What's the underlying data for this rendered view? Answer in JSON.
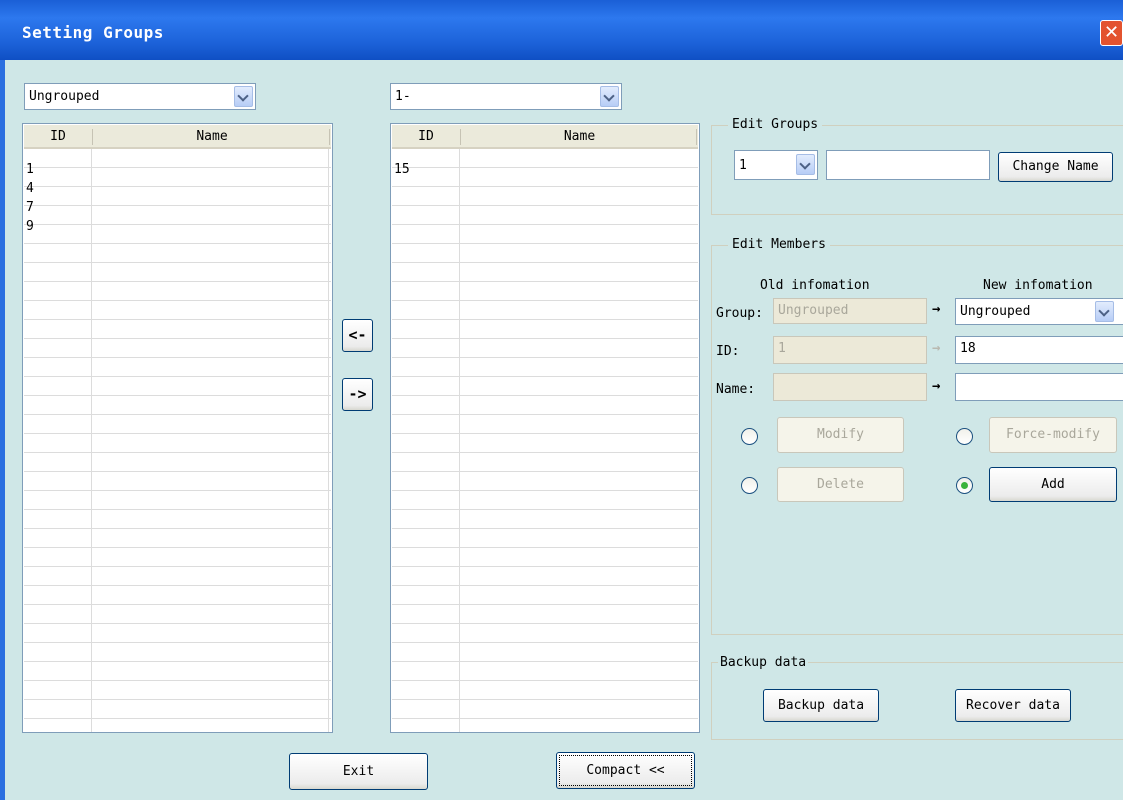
{
  "window": {
    "title": "Setting Groups",
    "close_glyph": "✕"
  },
  "left_panel": {
    "group_select": "Ungrouped",
    "columns": [
      "ID",
      "Name"
    ],
    "rows": [
      {
        "id": "1",
        "name": ""
      },
      {
        "id": "4",
        "name": ""
      },
      {
        "id": "7",
        "name": ""
      },
      {
        "id": "9",
        "name": ""
      }
    ]
  },
  "middle_panel": {
    "group_select": "1-",
    "columns": [
      "ID",
      "Name"
    ],
    "rows": [
      {
        "id": "15",
        "name": ""
      }
    ]
  },
  "transfer": {
    "to_left": "<-",
    "to_right": "->"
  },
  "edit_groups": {
    "legend": "Edit Groups",
    "group_number": "1",
    "name_value": "",
    "change_name_label": "Change Name"
  },
  "edit_members": {
    "legend": "Edit Members",
    "old_header": "Old infomation",
    "new_header": "New infomation",
    "group_label": "Group:",
    "id_label": "ID:",
    "name_label": "Name:",
    "old_group": "Ungrouped",
    "old_id": "1",
    "old_name": "",
    "new_group": "Ungrouped",
    "new_id": "18",
    "new_name": "",
    "modify_label": "Modify",
    "force_modify_label": "Force-modify",
    "delete_label": "Delete",
    "add_label": "Add",
    "selected_action": "Add"
  },
  "backup": {
    "legend": "Backup data",
    "backup_label": "Backup data",
    "recover_label": "Recover data"
  },
  "footer": {
    "exit_label": "Exit",
    "compact_label": "Compact <<"
  },
  "colors": {
    "background": "#cfe7e7",
    "titlebar": "#1d63da",
    "close": "#e3532f"
  }
}
